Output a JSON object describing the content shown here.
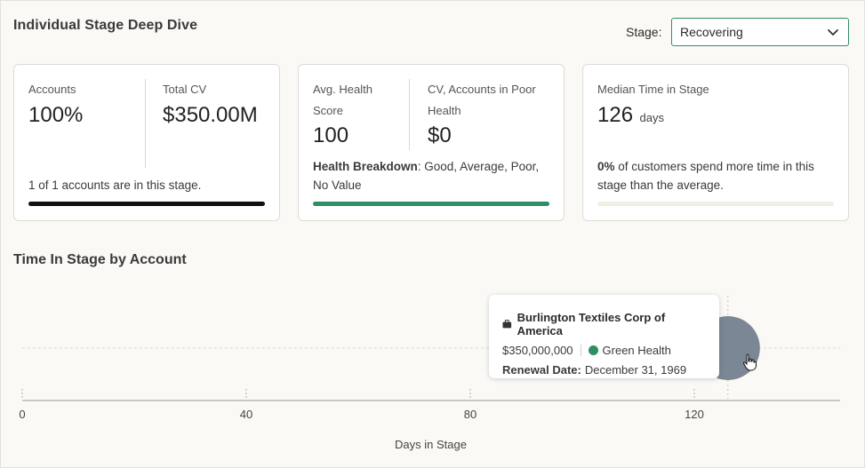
{
  "header": {
    "title": "Individual Stage Deep Dive",
    "stage_label": "Stage:",
    "stage_value": "Recovering"
  },
  "cards": {
    "accounts": {
      "accounts_label": "Accounts",
      "accounts_value": "100%",
      "cv_label": "Total CV",
      "cv_value": "$350.00M",
      "note": "1 of 1 accounts are in this stage.",
      "progress": 1.0
    },
    "health": {
      "avg_label_line1": "Avg. Health",
      "avg_label_line2": "Score",
      "avg_value": "100",
      "poor_label_line1": "CV, Accounts in Poor",
      "poor_label_line2": "Health",
      "poor_value": "$0",
      "breakdown_label": "Health Breakdown",
      "breakdown_text": ": Good, Average, Poor,",
      "breakdown_text2": "No Value",
      "progress": 1.0
    },
    "time": {
      "label": "Median Time in Stage",
      "value": "126",
      "unit": "days",
      "pct": "0%",
      "note_line1": " of customers spend more time in this",
      "note_line2": "stage than the average.",
      "progress": 0.0
    }
  },
  "colors": {
    "accent": "#2f8f62",
    "bar_black": "#111111",
    "bar_track": "#eef0e4",
    "bubble": "#7b8794"
  },
  "chart_data": {
    "type": "scatter",
    "title": "Time In Stage by Account",
    "xlabel": "Days in Stage",
    "ylabel": "",
    "xlim": [
      0,
      146
    ],
    "xticks": [
      "0",
      "40",
      "80",
      "120"
    ],
    "xtick_values": [
      0,
      40,
      80,
      120
    ],
    "points": [
      {
        "name": "Burlington Textiles Corp of America",
        "x": 126,
        "cv": 350000000
      }
    ],
    "grid": "horizontal-dashed",
    "tooltip": {
      "name": "Burlington Textiles Corp of America",
      "amount": "$350,000,000",
      "health": "Green Health",
      "renewal_label": "Renewal Date:",
      "renewal_value": "December 31, 1969"
    }
  }
}
